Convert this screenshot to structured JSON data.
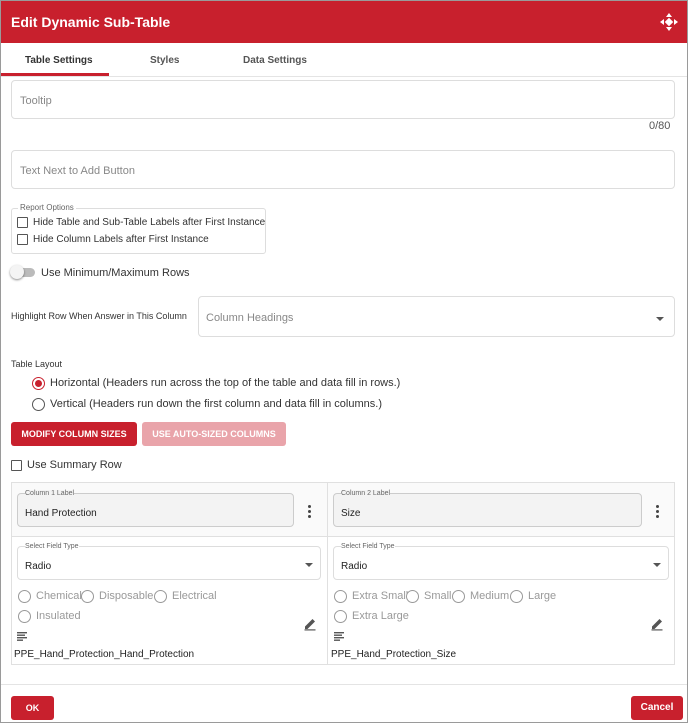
{
  "window": {
    "title": "Edit Dynamic Sub-Table",
    "move_icon": "move-arrows-icon"
  },
  "tabs": [
    {
      "label": "Table Settings",
      "active": true
    },
    {
      "label": "Styles",
      "active": false
    },
    {
      "label": "Data Settings",
      "active": false
    }
  ],
  "tooltip": {
    "placeholder": "Tooltip",
    "counter": "0/80"
  },
  "add_button_text": {
    "placeholder": "Text Next to Add Button"
  },
  "report_options": {
    "legend": "Report Options",
    "items": [
      {
        "label": "Hide Table and Sub-Table Labels after First Instance",
        "checked": false
      },
      {
        "label": "Hide Column Labels after First Instance",
        "checked": false
      }
    ]
  },
  "min_max_rows": {
    "label": "Use Minimum/Maximum Rows",
    "enabled": false
  },
  "highlight_row": {
    "label": "Highlight Row When Answer in This Column",
    "placeholder": "Column Headings"
  },
  "table_layout": {
    "label": "Table Layout",
    "options": [
      {
        "label": "Horizontal (Headers run across the top of the table and data fill in rows.)",
        "selected": true
      },
      {
        "label": "Vertical (Headers run down the first column and data fill in columns.)",
        "selected": false
      }
    ]
  },
  "buttons": {
    "modify_sizes": "MODIFY COLUMN SIZES",
    "auto_sized": "USE AUTO-SIZED COLUMNS"
  },
  "summary_row": {
    "label": "Use Summary Row",
    "checked": false
  },
  "columns": [
    {
      "label_caption": "Column 1 Label",
      "label_value": "Hand Protection",
      "field_type_caption": "Select Field Type",
      "field_type": "Radio",
      "options": [
        "Chemical",
        "Disposable",
        "Electrical",
        "Insulated"
      ],
      "variable": "PPE_Hand_Protection_Hand_Protection"
    },
    {
      "label_caption": "Column 2 Label",
      "label_value": "Size",
      "field_type_caption": "Select Field Type",
      "field_type": "Radio",
      "options": [
        "Extra Small",
        "Small",
        "Medium",
        "Large",
        "Extra Large"
      ],
      "variable": "PPE_Hand_Protection_Size"
    }
  ],
  "footer": {
    "ok": "OK",
    "cancel": "Cancel"
  },
  "colors": {
    "accent": "#c8202d",
    "disabled_accent": "#e9a4aa"
  }
}
